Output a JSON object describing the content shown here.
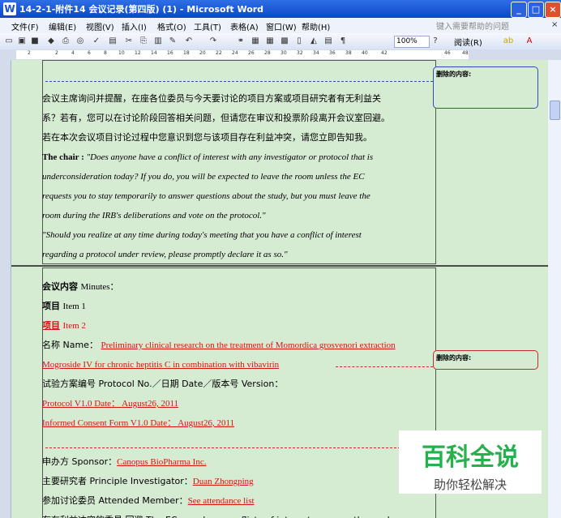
{
  "window": {
    "title": "14-2-1-附件14 会议记录(第四版) (1) - Microsoft Word"
  },
  "menu": {
    "items": [
      "文件(F)",
      "编辑(E)",
      "视图(V)",
      "插入(I)",
      "格式(O)",
      "工具(T)",
      "表格(A)",
      "窗口(W)",
      "帮助(H)"
    ],
    "help_placeholder": "键入需要帮助的问题"
  },
  "toolbar": {
    "zoom": "100%",
    "read_label": "阅读(R)"
  },
  "ruler": {
    "numbers": [
      "2",
      "2",
      "4",
      "6",
      "8",
      "10",
      "12",
      "14",
      "16",
      "18",
      "20",
      "22",
      "24",
      "26",
      "28",
      "30",
      "32",
      "34",
      "36",
      "38",
      "40",
      "42",
      "46",
      "48"
    ]
  },
  "page1": {
    "lines": [
      "会议主席询问并提醒，在座各位委员与今天要讨论的项目方案或项目研究者有无利益关",
      "系？若有，您可以在讨论阶段回答相关问题，但请您在审议和投票阶段离开会议室回避。",
      "若在本次会议项目讨论过程中您意识到您与该项目存在利益冲突，请您立即告知我。"
    ],
    "chair_label": "The chair :",
    "en_lines": [
      "\"Does anyone have a conflict of interest with any investigator or protocol that is",
      "underconsideration today? If you do, you will be expected to leave the room unless the EC",
      "requests you to stay temporarily to answer questions about the study, but you must leave the",
      "room during the IRB's deliberations and vote on the protocol.\"",
      "\"Should you realize at any time during today's meeting that you have a conflict of interest",
      "regarding a protocol under review, please promptly declare it as so.\""
    ]
  },
  "page2": {
    "content_label": "会议内容",
    "content_en": "Minutes：",
    "item1_label": "项目",
    "item1_en": "Item 1",
    "item2_label": "项目",
    "item2_en": "Item 2",
    "name_label": "名称 Name：",
    "name_value": "Preliminary clinical research on the treatment of Momordica grosvenori extraction",
    "name_value2": "Mogroside IV for chronic heptitis C in combination with vibavirin",
    "protocol_label": "试验方案编号 Protocol No.／日期 Date／版本号 Version：",
    "protocol_value": "Protocol    V1.0    Date：    August26, 2011",
    "icf_value": "Informed Consent Form      V1.0    Date：    August26, 2011",
    "sponsor_label": "申办方 Sponsor：",
    "sponsor_value": "Canopus BioPharma Inc.",
    "pi_label": "主要研究者 Principle Investigator：",
    "pi_value": "Duan Zhongping",
    "member_label": "参加讨论委员 Attended Member：",
    "member_value": "See attendance list",
    "cut_line": "存在利益冲突的委员 回避 The EC members conflicts of interest，excuse themselves"
  },
  "balloons": {
    "deleted1": "删除的内容:",
    "deleted2": "删除的内容:"
  },
  "watermark": {
    "big": "百科全说",
    "small": "助你轻松解决",
    "color": "#28b04c"
  }
}
